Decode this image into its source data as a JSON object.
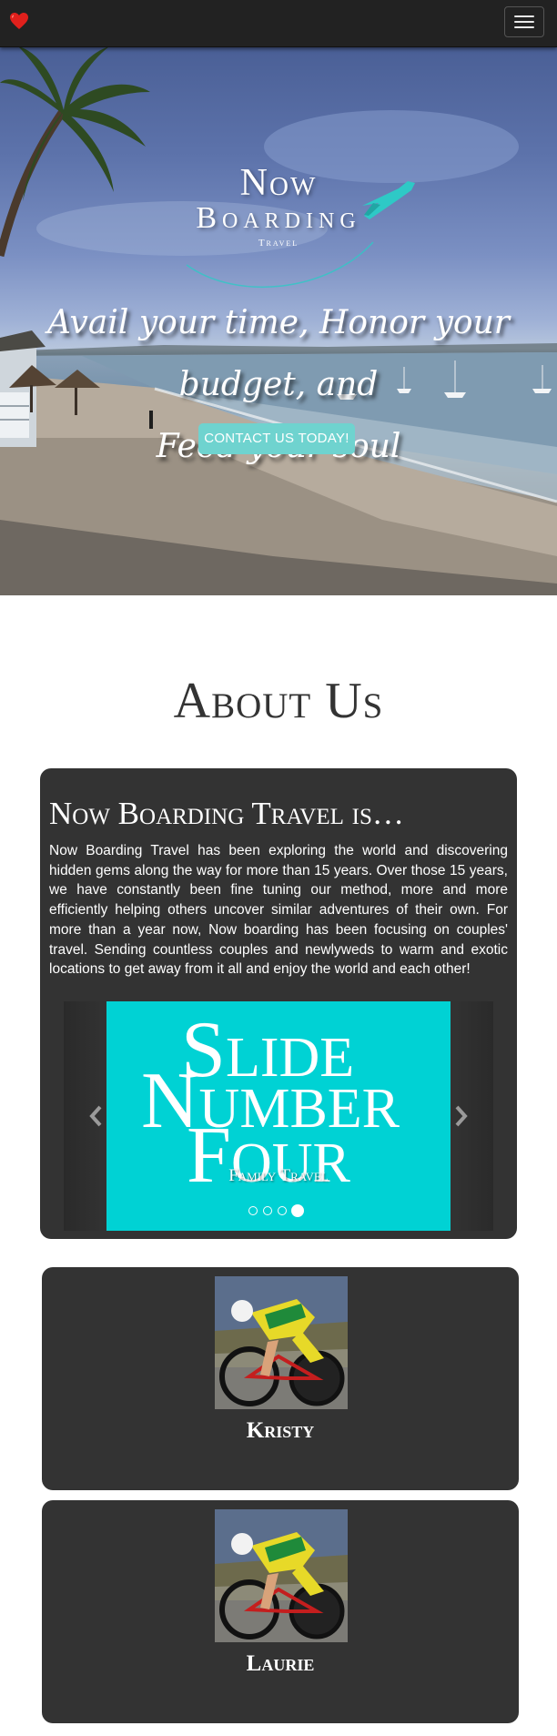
{
  "navbar": {
    "brand_icon": "heart-icon",
    "brand_color": "#e0201c",
    "menu_icon": "hamburger-menu-icon"
  },
  "hero": {
    "logo": {
      "line1": "Now",
      "line2": "Boarding",
      "line3": "Travel",
      "icon": "airplane-icon",
      "icon_color": "#2ec9c6"
    },
    "tagline_line1": "Avail your time, Honor your budget, and",
    "tagline_line2": "Feed your soul",
    "cta_label": "CONTACT US TODAY!",
    "cta_color": "#6fd3cf"
  },
  "about": {
    "title": "About Us",
    "heading": "Now Boarding Travel is…",
    "body": "Now Boarding Travel has been exploring the world and discovering hidden gems along the way for more than 15 years. Over those 15 years, we have constantly been fine tuning our method, more and more efficiently helping others uncover similar adventures of their own. For more than a year now, Now boarding has been focusing on couples' travel. Sending countless couples and newlyweds to warm and exotic locations to get away from it all and enjoy the world and each other!",
    "carousel": {
      "slide_word1": "Slide",
      "slide_word2": "Number",
      "slide_word3": "Four",
      "caption": "Family Travel",
      "slide_color": "#00d2d4",
      "prev_icon": "chevron-left-icon",
      "next_icon": "chevron-right-icon",
      "indicator_count": 4,
      "active_index": 4
    }
  },
  "team": [
    {
      "name": "Kristy",
      "photo_icon": "cyclist-photo"
    },
    {
      "name": "Laurie",
      "photo_icon": "cyclist-photo"
    }
  ],
  "colors": {
    "card_bg": "#333333",
    "navbar_bg": "#222222",
    "page_bg": "#ffffff"
  }
}
